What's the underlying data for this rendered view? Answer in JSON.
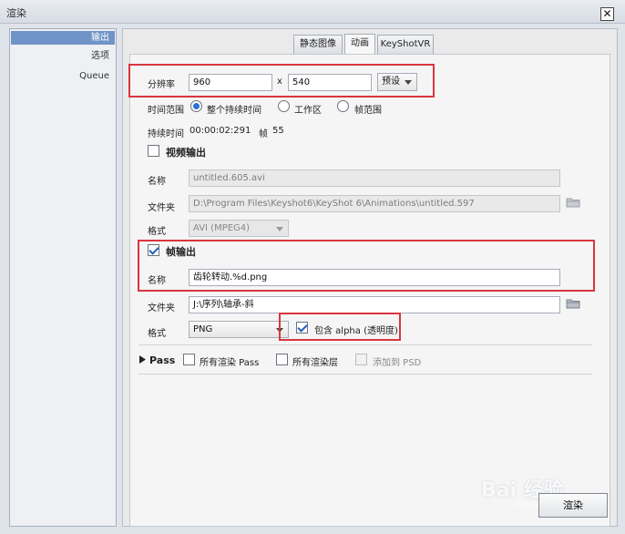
{
  "window": {
    "title": "渲染",
    "close_glyph": "✕"
  },
  "sidebar": {
    "items": [
      {
        "label": "输出",
        "active": true
      },
      {
        "label": "选项",
        "active": false
      },
      {
        "label": "Queue",
        "active": false
      }
    ]
  },
  "tabs": [
    {
      "label": "静态图像",
      "active": false
    },
    {
      "label": "动画",
      "active": true
    },
    {
      "label": "KeyShotVR",
      "active": false
    }
  ],
  "resolution": {
    "label": "分辨率",
    "width": "960",
    "separator": "x",
    "height": "540",
    "preset_label": "预设"
  },
  "time_range": {
    "label": "时间范围",
    "options": [
      {
        "label": "整个持续时间",
        "selected": true
      },
      {
        "label": "工作区",
        "selected": false
      },
      {
        "label": "帧范围",
        "selected": false
      }
    ]
  },
  "duration": {
    "label": "持续时间",
    "value": "00:00:02:291",
    "frames_label": "帧",
    "frames_value": "55"
  },
  "video_output": {
    "label": "视频输出",
    "checked": false,
    "name_label": "名称",
    "name_value": "untitled.605.avi",
    "folder_label": "文件夹",
    "folder_value": "D:\\Program Files\\Keyshot6\\KeyShot 6\\Animations\\untitled.597",
    "format_label": "格式",
    "format_value": "AVI (MPEG4)"
  },
  "frame_output": {
    "label": "帧输出",
    "checked": true,
    "name_label": "名称",
    "name_value": "齿轮转动.%d.png",
    "folder_label": "文件夹",
    "folder_value": "J:\\序列\\轴承-斜",
    "format_label": "格式",
    "format_value": "PNG",
    "alpha_label": "包含 alpha (透明度)",
    "alpha_checked": true
  },
  "pass": {
    "label": "Pass",
    "all_passes_label": "所有渲染 Pass",
    "all_layers_label": "所有渲染层",
    "add_to_psd_label": "添加到 PSD"
  },
  "footer": {
    "render_label": "渲染"
  },
  "watermark": {
    "text": "Bai 经验",
    "sub": "jingyan.baidu.com"
  },
  "colors": {
    "highlight": "#d9363e",
    "accent": "#2a6fd6",
    "sidebar_active": "#6f94c8"
  },
  "icons": [
    "close-icon",
    "folder-icon",
    "chevron-down-icon",
    "triangle-right-icon",
    "checkmark-icon"
  ]
}
